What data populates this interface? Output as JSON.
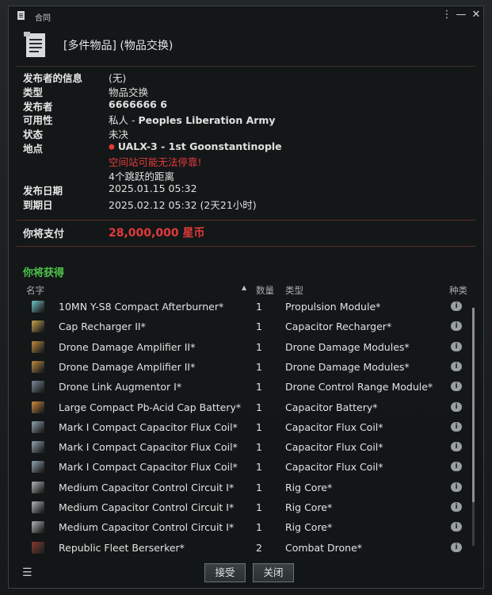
{
  "window": {
    "title": "合同"
  },
  "contract": {
    "title": "[多件物品] (物品交换)"
  },
  "info": {
    "issuer_info_label": "发布者的信息",
    "issuer_info_value": "(无)",
    "type_label": "类型",
    "type_value": "物品交换",
    "issuer_label": "发布者",
    "issuer_value": "6666666 6",
    "availability_label": "可用性",
    "availability_prefix": "私人 - ",
    "availability_value": "Peoples Liberation Army",
    "status_label": "状态",
    "status_value": "未决",
    "location_label": "地点",
    "location_value": "UALX-3 - 1st Goonstantinople",
    "dock_warning": "空间站可能无法停靠!",
    "jumps": "4个跳跃的距离",
    "issued_label": "发布日期",
    "issued_value": "2025.01.15 05:32",
    "expires_label": "到期日",
    "expires_value": "2025.02.12 05:32 (2天21小时)"
  },
  "payment": {
    "label": "你将支付",
    "amount": "28,000,000 星币"
  },
  "receive": {
    "label": "你将获得"
  },
  "table": {
    "headers": {
      "name": "名字",
      "qty": "数量",
      "type": "类型",
      "category": "种类"
    },
    "rows": [
      {
        "name": "10MN Y-S8 Compact Afterburner*",
        "qty": "1",
        "type": "Propulsion Module*",
        "icon": "afterburner-icon",
        "color": "#6fc2c4"
      },
      {
        "name": "Cap Recharger II*",
        "qty": "1",
        "type": "Capacitor Recharger*",
        "icon": "cap-recharger-icon",
        "color": "#c9a24a"
      },
      {
        "name": "Drone Damage Amplifier II*",
        "qty": "1",
        "type": "Drone Damage Modules*",
        "icon": "drone-damage-amplifier-icon",
        "color": "#c08a3c"
      },
      {
        "name": "Drone Damage Amplifier II*",
        "qty": "1",
        "type": "Drone Damage Modules*",
        "icon": "drone-damage-amplifier-icon",
        "color": "#c08a3c"
      },
      {
        "name": "Drone Link Augmentor I*",
        "qty": "1",
        "type": "Drone Control Range Module*",
        "icon": "drone-link-augmentor-icon",
        "color": "#7a8a9a"
      },
      {
        "name": "Large Compact Pb-Acid Cap Battery*",
        "qty": "1",
        "type": "Capacitor Battery*",
        "icon": "cap-battery-icon",
        "color": "#d08a3a"
      },
      {
        "name": "Mark I Compact Capacitor Flux Coil*",
        "qty": "1",
        "type": "Capacitor Flux Coil*",
        "icon": "flux-coil-icon",
        "color": "#8fa4b0"
      },
      {
        "name": "Mark I Compact Capacitor Flux Coil*",
        "qty": "1",
        "type": "Capacitor Flux Coil*",
        "icon": "flux-coil-icon",
        "color": "#8fa4b0"
      },
      {
        "name": "Mark I Compact Capacitor Flux Coil*",
        "qty": "1",
        "type": "Capacitor Flux Coil*",
        "icon": "flux-coil-icon",
        "color": "#8fa4b0"
      },
      {
        "name": "Medium Capacitor Control Circuit I*",
        "qty": "1",
        "type": "Rig Core*",
        "icon": "rig-icon",
        "color": "#b0b4b6"
      },
      {
        "name": "Medium Capacitor Control Circuit I*",
        "qty": "1",
        "type": "Rig Core*",
        "icon": "rig-icon",
        "color": "#b0b4b6"
      },
      {
        "name": "Medium Capacitor Control Circuit I*",
        "qty": "1",
        "type": "Rig Core*",
        "icon": "rig-icon",
        "color": "#b0b4b6"
      },
      {
        "name": "Republic Fleet Berserker*",
        "qty": "2",
        "type": "Combat Drone*",
        "icon": "combat-drone-icon",
        "color": "#8a3a2a"
      }
    ]
  },
  "buttons": {
    "accept": "接受",
    "close": "关闭"
  },
  "colors": {
    "accent_red": "#e23a3a",
    "accent_green": "#4cc44a"
  }
}
